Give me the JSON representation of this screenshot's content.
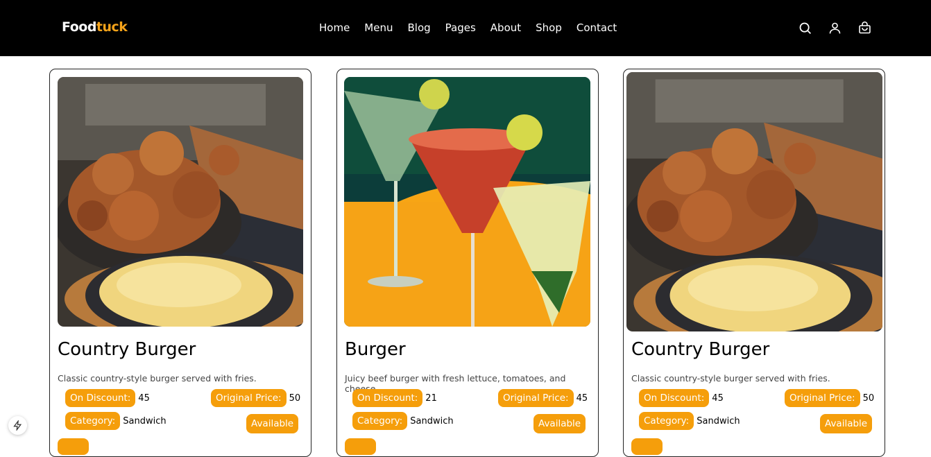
{
  "brand": {
    "part1": "Food",
    "part2": "tuck",
    "accent": "#f5a31a"
  },
  "nav": {
    "items": [
      "Home",
      "Menu",
      "Blog",
      "Pages",
      "About",
      "Shop",
      "Contact"
    ]
  },
  "icons": {
    "search": "search-icon",
    "user": "user-icon",
    "bag": "shopping-bag-icon"
  },
  "labels": {
    "discount": "On Discount:",
    "original": "Original Price:",
    "category": "Category:",
    "available": "Available"
  },
  "products": [
    {
      "name": "Country Burger",
      "description": "Classic country-style burger served with fries.",
      "discount": "45",
      "original_price": "50",
      "category": "Sandwich",
      "image": "fried-chicken-and-corn-photo"
    },
    {
      "name": "Burger",
      "description": "Juicy beef burger with fresh lettuce, tomatoes, and cheese.",
      "discount": "21",
      "original_price": "45",
      "category": "Sandwich",
      "image": "cocktails-photo"
    },
    {
      "name": "Country Burger",
      "description": "Classic country-style burger served with fries.",
      "discount": "45",
      "original_price": "50",
      "category": "Sandwich",
      "image": "fried-chicken-and-corn-photo"
    }
  ],
  "colors": {
    "badge": "#f59e0b",
    "header_bg": "#000000"
  }
}
